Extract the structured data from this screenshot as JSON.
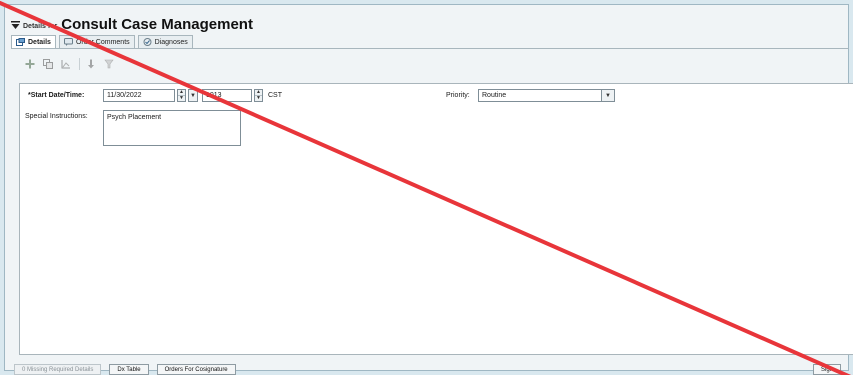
{
  "header": {
    "prefix": "Details for",
    "title": "Consult Case Management"
  },
  "tabs": [
    {
      "label": "Details",
      "icon": "details-icon",
      "active": true
    },
    {
      "label": "Order Comments",
      "icon": "comments-icon",
      "active": false
    },
    {
      "label": "Diagnoses",
      "icon": "diagnoses-icon",
      "active": false
    }
  ],
  "toolbar": {
    "icons": [
      "add-icon",
      "copy-icon",
      "chart-icon",
      "sort-down-icon",
      "filter-icon"
    ]
  },
  "form": {
    "start_datetime_label": "*Start Date/Time:",
    "start_date_value": "11/30/2022",
    "start_time_value": "1013",
    "timezone": "CST",
    "priority_label": "Priority:",
    "priority_value": "Routine",
    "special_instructions_label": "Special Instructions:",
    "special_instructions_value": "Psych Placement"
  },
  "footer": {
    "missing_details": "0 Missing Required Details",
    "dx_table": "Dx Table",
    "orders_for_cosignature": "Orders For Cosignature",
    "sign": "Sign"
  },
  "colors": {
    "annotation_line": "#e8353a",
    "background": "#d9e8ef"
  }
}
